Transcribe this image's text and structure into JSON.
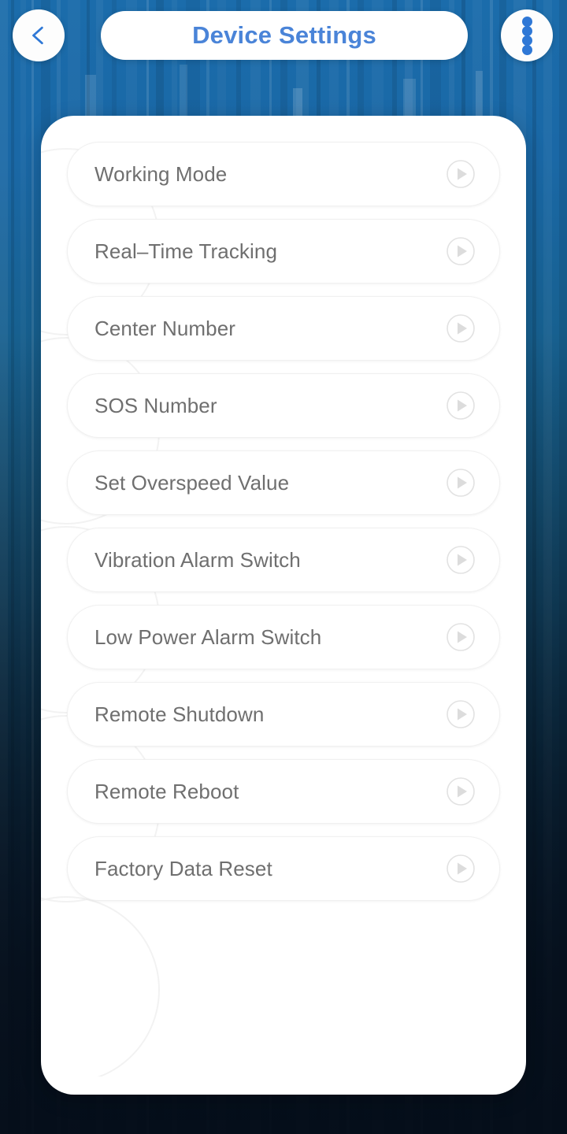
{
  "header": {
    "title": "Device Settings",
    "back_icon": "chevron-left-icon",
    "menu_icon": "vertical-dots-menu-icon",
    "menu_dot_count": 4,
    "title_color": "#4a84d8",
    "accent_color": "#2f78d6"
  },
  "settings_list": {
    "chevron_icon": "play-circle-chevron-icon",
    "label_color": "#6f6f6f",
    "items": [
      {
        "label": "Working Mode"
      },
      {
        "label": "Real–Time Tracking"
      },
      {
        "label": "Center Number"
      },
      {
        "label": "SOS Number"
      },
      {
        "label": "Set Overspeed Value"
      },
      {
        "label": "Vibration Alarm Switch"
      },
      {
        "label": "Low Power Alarm Switch"
      },
      {
        "label": "Remote Shutdown"
      },
      {
        "label": "Remote Reboot"
      },
      {
        "label": "Factory Data Reset"
      }
    ]
  },
  "background": {
    "top_color": "#1b6cab",
    "bottom_color": "#091320",
    "style": "vertical-streak-bars-blue-gradient"
  }
}
